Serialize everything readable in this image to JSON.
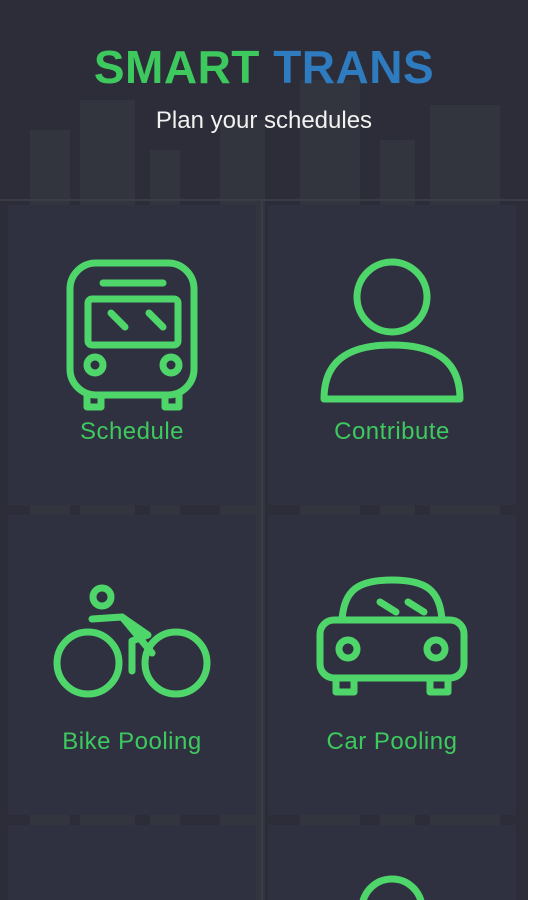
{
  "colors": {
    "brand_green": "#3ec95e",
    "brand_blue": "#2e7bbf",
    "icon_green": "#4fd66a",
    "background": "#2c2d38",
    "tile": "#2f3140"
  },
  "header": {
    "title_part1": "SMART",
    "title_part2": "TRANS",
    "subtitle": "Plan your schedules"
  },
  "tiles": [
    {
      "label": "Schedule",
      "icon": "bus-icon"
    },
    {
      "label": "Contribute",
      "icon": "person-icon"
    },
    {
      "label": "Bike Pooling",
      "icon": "bike-icon"
    },
    {
      "label": "Car Pooling",
      "icon": "car-icon"
    },
    {
      "label": "",
      "icon": ""
    },
    {
      "label": "",
      "icon": "circle-icon"
    }
  ]
}
